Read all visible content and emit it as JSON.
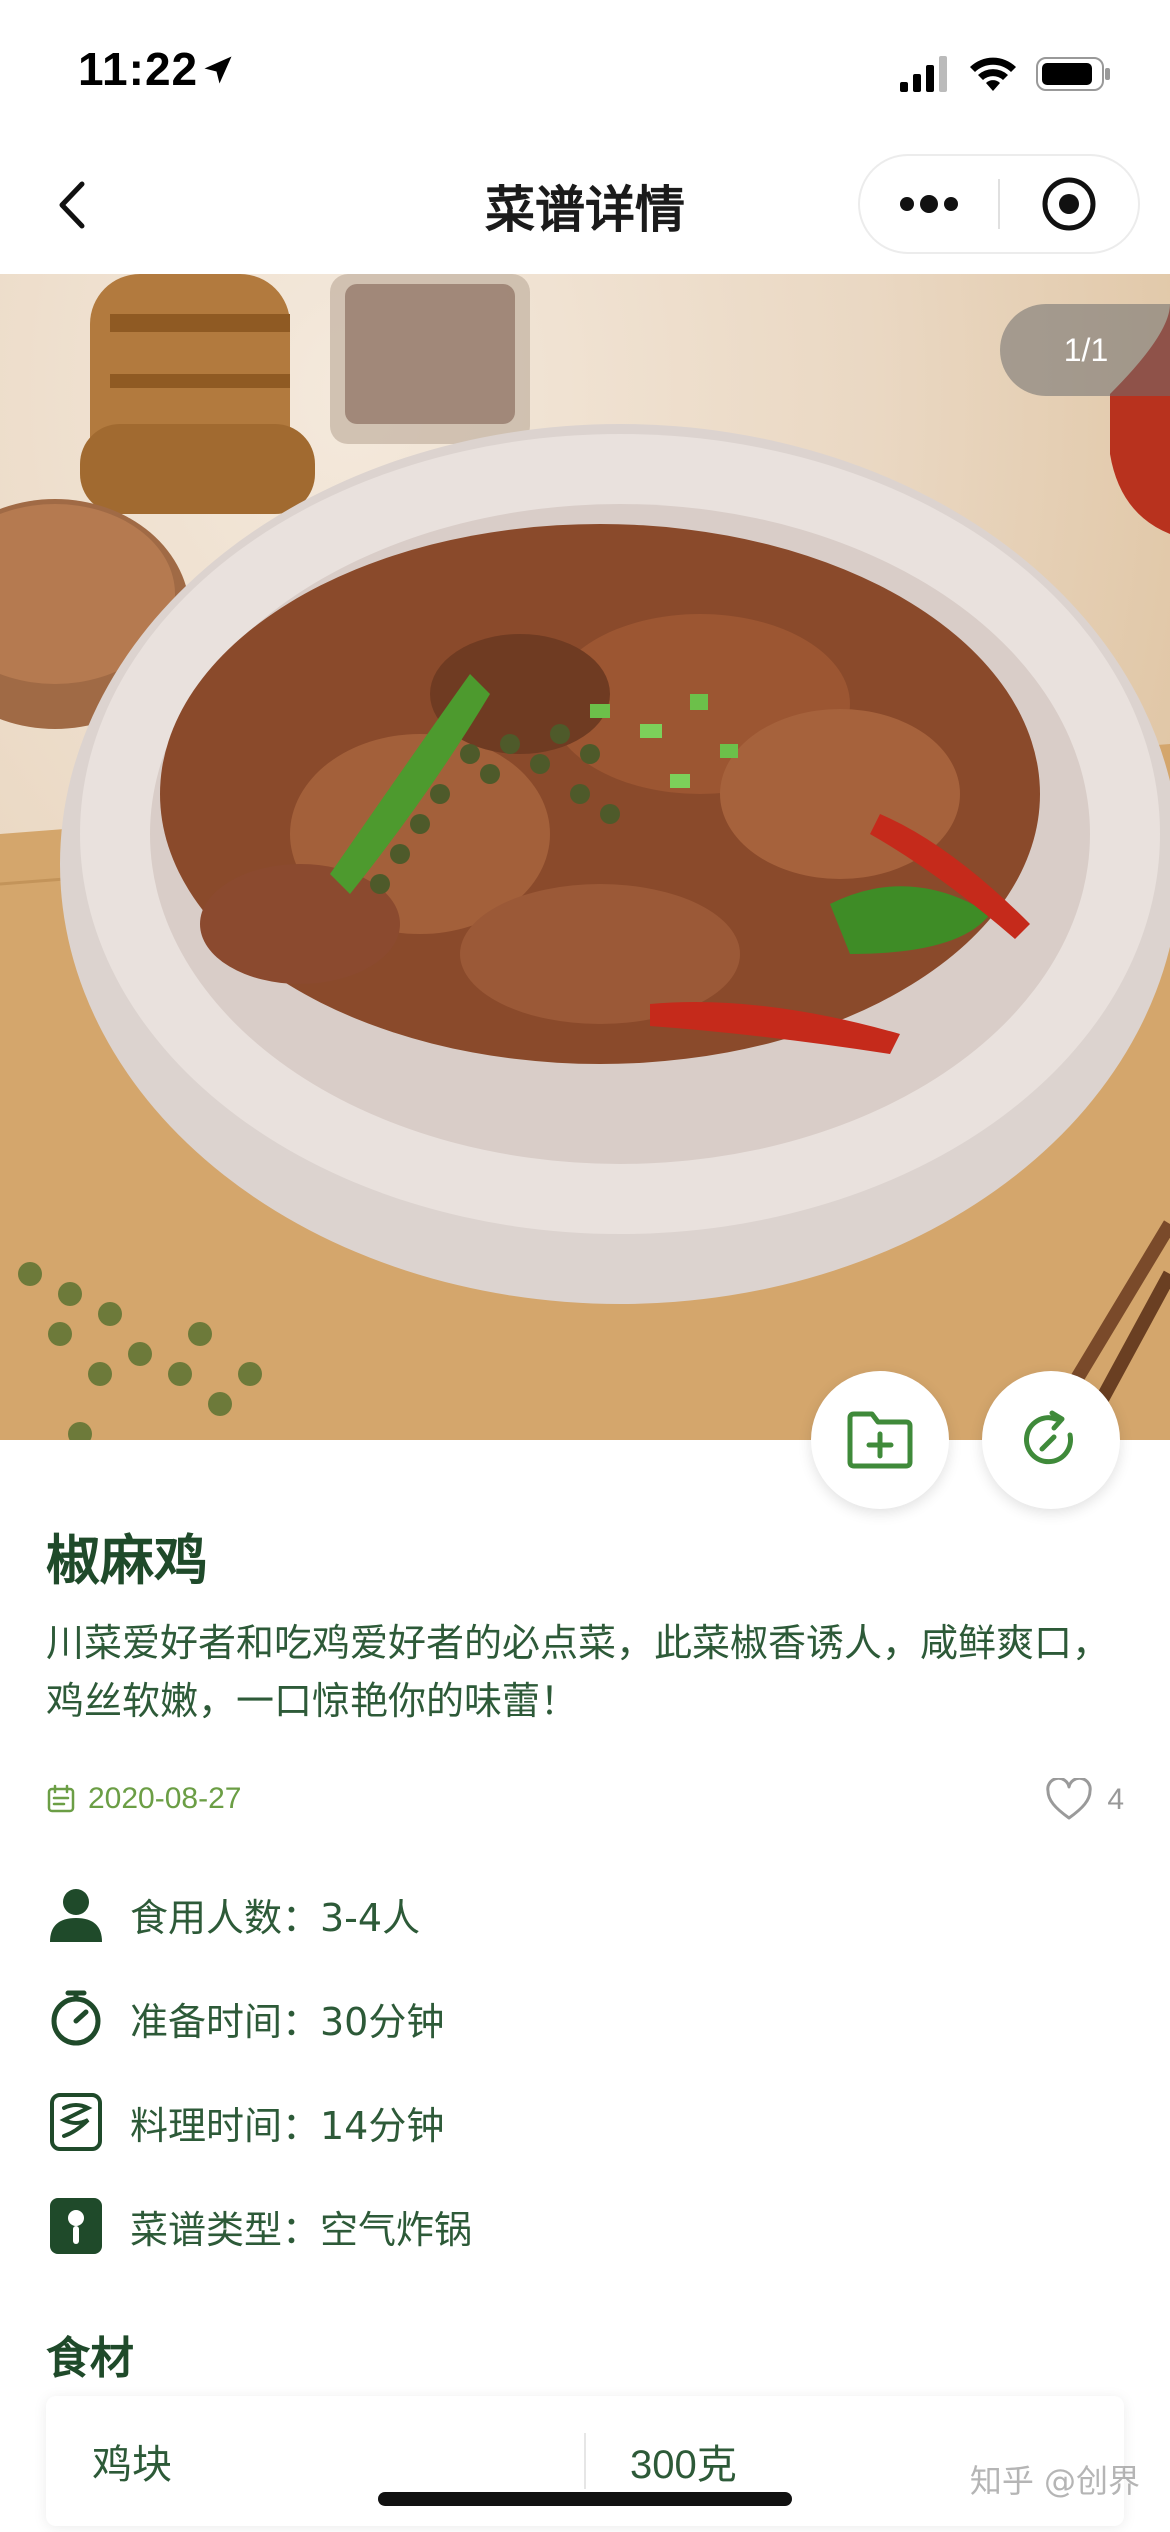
{
  "status_bar": {
    "time": "11:22"
  },
  "nav": {
    "title": "菜谱详情"
  },
  "hero": {
    "counter": "1/1"
  },
  "recipe": {
    "title": "椒麻鸡",
    "description": "川菜爱好者和吃鸡爱好者的必点菜，此菜椒香诱人，咸鲜爽口，鸡丝软嫩，一口惊艳你的味蕾！",
    "date": "2020-08-27",
    "likes": "4",
    "info": [
      {
        "icon": "person-icon",
        "text": "食用人数：3-4人"
      },
      {
        "icon": "timer-icon",
        "text": "准备时间：30分钟"
      },
      {
        "icon": "cooking-coil-icon",
        "text": "料理时间：14分钟"
      },
      {
        "icon": "air-fryer-icon",
        "text": "菜谱类型：空气炸锅"
      }
    ]
  },
  "ingredients": {
    "title": "食材",
    "items": [
      {
        "name": "鸡块",
        "quantity": "300克"
      }
    ]
  },
  "watermark": "知乎 @创界",
  "colors": {
    "accent": "#1f4a2a",
    "date_green": "#6b9e45",
    "fab_green": "#3f8a3a"
  }
}
